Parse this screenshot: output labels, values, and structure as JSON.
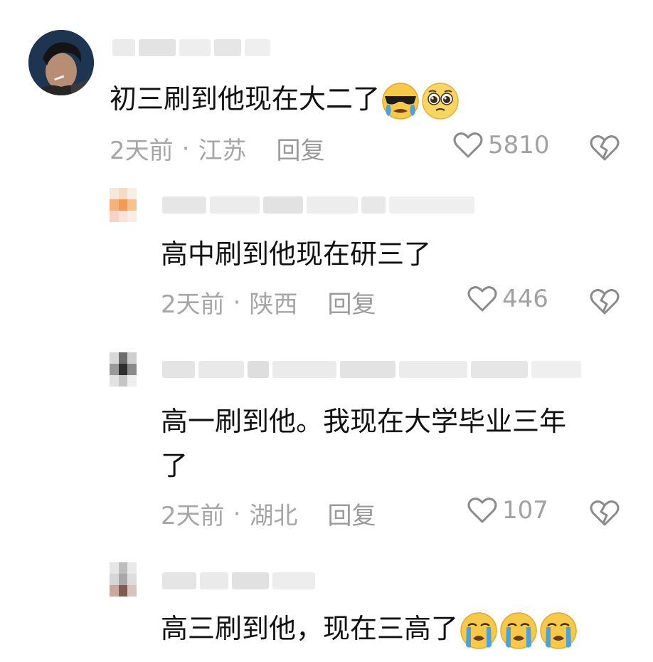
{
  "comments": [
    {
      "text": "初三刷到他现在大二了",
      "time": "2天前",
      "sep": "·",
      "location": "江苏",
      "reply_label": "回复",
      "likes": "5810",
      "emojis": [
        "cool-crying-emoji",
        "pleading-emoji"
      ]
    },
    {
      "text": "高中刷到他现在研三了",
      "time": "2天前",
      "sep": "·",
      "location": "陕西",
      "reply_label": "回复",
      "likes": "446"
    },
    {
      "text_line1": "高一刷到他。我现在大学毕业三年",
      "text_line2": "了",
      "time": "2天前",
      "sep": "·",
      "location": "湖北",
      "reply_label": "回复",
      "likes": "107"
    },
    {
      "text": "高三刷到他，现在三高了",
      "emojis": [
        "loudly-crying-emoji",
        "loudly-crying-emoji",
        "loudly-crying-emoji"
      ]
    }
  ],
  "colors": {
    "meta_gray": "#a6a6a6",
    "blur_gray": "#e7e7e7",
    "emoji_yellow": "#f7c948",
    "tear_blue": "#4aa3df"
  }
}
